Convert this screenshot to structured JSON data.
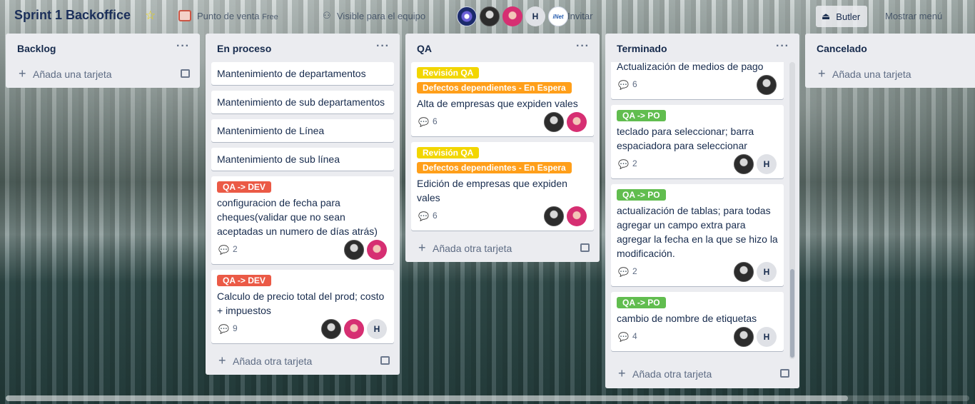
{
  "header": {
    "board_title": "Sprint 1 Backoffice",
    "team": "Punto de venta",
    "team_badge": "Free",
    "visibility": "Visible para el equipo",
    "invite": "Invitar",
    "butler": "Butler",
    "menu": "Mostrar menú",
    "member_H": "H",
    "member_inet": "iNet"
  },
  "lists": {
    "backlog": {
      "title": "Backlog",
      "add": "Añada una tarjeta"
    },
    "en_proceso": {
      "title": "En proceso",
      "add": "Añada otra tarjeta",
      "cards": [
        {
          "title": "Mantenimiento de departamentos"
        },
        {
          "title": "Mantenimiento de sub departamentos"
        },
        {
          "title": "Mantenimiento de Línea"
        },
        {
          "title": "Mantenimiento de sub línea"
        },
        {
          "label": "QA -> DEV",
          "title": "configuracion de fecha para cheques(validar que no sean aceptadas un numero de días atrás)",
          "comments": "2"
        },
        {
          "label": "QA -> DEV",
          "title": "Calculo de precio total del prod; costo + impuestos",
          "comments": "9",
          "member_h": "H"
        }
      ]
    },
    "qa": {
      "title": "QA",
      "add": "Añada otra tarjeta",
      "cards": [
        {
          "label1": "Revisión QA",
          "label2": "Defectos dependientes - En Espera",
          "title": "Alta de empresas que expiden vales",
          "comments": "6"
        },
        {
          "label1": "Revisión QA",
          "label2": "Defectos dependientes - En Espera",
          "title": "Edición de empresas que expiden vales",
          "comments": "6"
        }
      ]
    },
    "terminado": {
      "title": "Terminado",
      "add": "Añada otra tarjeta",
      "cards": [
        {
          "title": "Actualización de medios de pago",
          "comments": "6"
        },
        {
          "label": "QA -> PO",
          "title": "teclado para seleccionar; barra espaciadora para seleccionar",
          "comments": "2",
          "member_h": "H"
        },
        {
          "label": "QA -> PO",
          "title": "actualización de tablas; para todas agregar un campo extra para agregar la fecha en la que se hizo la modificación.",
          "comments": "2",
          "member_h": "H"
        },
        {
          "label": "QA -> PO",
          "title": "cambio de nombre de etiquetas",
          "comments": "4",
          "member_h": "H"
        }
      ]
    },
    "cancelado": {
      "title": "Cancelado",
      "add": "Añada una tarjeta"
    }
  },
  "icons": {
    "star": "star-icon",
    "comment": "comment-icon",
    "add": "plus-icon",
    "template": "card-template-icon",
    "butler": "butler-icon"
  },
  "colors": {
    "label_red": "#eb5a46",
    "label_green": "#61bd4f",
    "label_yellow": "#f2d600",
    "label_orange": "#ff9f1a",
    "list_bg": "#ebecf0"
  }
}
